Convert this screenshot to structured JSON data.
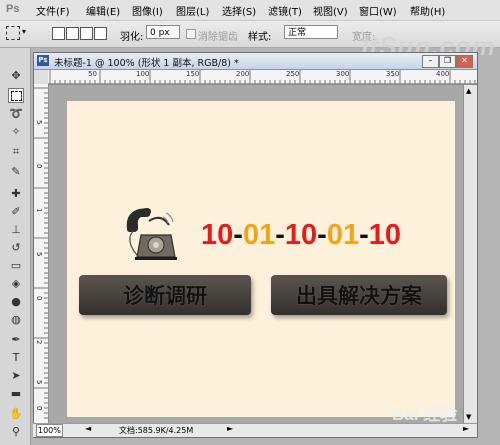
{
  "app_logo": "Ps",
  "menu": {
    "items": [
      "文件(F)",
      "编辑(E)",
      "图像(I)",
      "图层(L)",
      "选择(S)",
      "滤镜(T)",
      "视图(V)",
      "窗口(W)",
      "帮助(H)"
    ]
  },
  "options_bar": {
    "feather_label": "羽化:",
    "feather_value": "0 px",
    "antialias_label": "消除锯齿",
    "style_label": "样式:",
    "style_value": "正常",
    "width_label": "宽度:"
  },
  "watermark_top": "ItSun.com",
  "document": {
    "title": "未标题-1 @ 100% (形状 1 副本, RGB/8) *",
    "ruler_ticks": [
      "50",
      "100",
      "150",
      "200",
      "250",
      "300",
      "350",
      "400"
    ],
    "ruler_v_ticks": [
      "5",
      "0",
      "1",
      "5",
      "0",
      "2",
      "5",
      "0"
    ]
  },
  "canvas": {
    "phone_number": {
      "segments": [
        {
          "text": "10",
          "color": "#e71b1b"
        },
        {
          "text": "-",
          "color": "#111111"
        },
        {
          "text": "01",
          "color": "#f4a316"
        },
        {
          "text": "-",
          "color": "#111111"
        },
        {
          "text": "10",
          "color": "#e71b1b"
        },
        {
          "text": "-",
          "color": "#111111"
        },
        {
          "text": "01",
          "color": "#f4a316"
        },
        {
          "text": "-",
          "color": "#111111"
        },
        {
          "text": "10",
          "color": "#e71b1b"
        }
      ]
    },
    "buttons": [
      "诊断调研",
      "出具解决方案"
    ]
  },
  "statusbar": {
    "zoom": "100%",
    "doc_info": "文档:585.9K/4.25M"
  },
  "watermark_bottom": "Bai 经验"
}
